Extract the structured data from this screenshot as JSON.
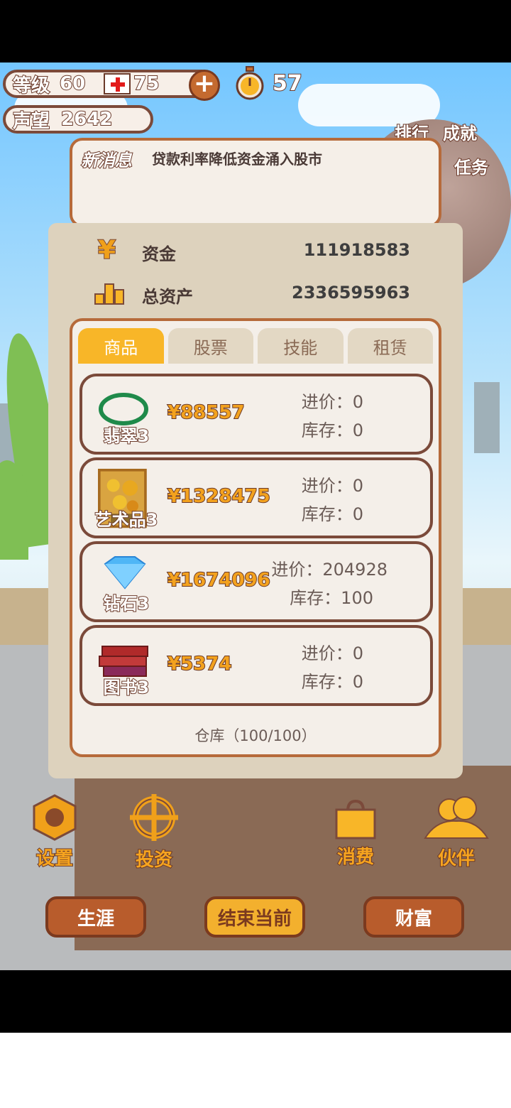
{
  "hud": {
    "level_label": "等级",
    "level_value": "60",
    "health_value": "75",
    "add_label": "+",
    "timer_value": "57",
    "reputation_label": "声望",
    "reputation_value": "2642"
  },
  "side_links": {
    "ranking": "排行",
    "achievements": "成就",
    "tasks": "任务"
  },
  "message": {
    "tag": "新消息",
    "text": "贷款利率降低资金涌入股市"
  },
  "stats": {
    "funds_icon": "¥",
    "funds_label": "资金",
    "funds_value": "111918583",
    "assets_label": "总资产",
    "assets_value": "2336595963"
  },
  "tabs": [
    "商品",
    "股票",
    "技能",
    "租赁"
  ],
  "active_tab": "商品",
  "items": [
    {
      "name": "翡翠3",
      "icon": "jade-bracelet-icon",
      "price": "¥88557",
      "cost": "进价：0",
      "stock": "库存：0"
    },
    {
      "name": "艺术品3",
      "icon": "sunflower-painting-icon",
      "price": "¥1328475",
      "cost": "进价：0",
      "stock": "库存：0"
    },
    {
      "name": "钻石3",
      "icon": "diamond-icon",
      "price": "¥1674096",
      "cost": "进价：204928",
      "stock": "库存：100"
    },
    {
      "name": "图书3",
      "icon": "books-icon",
      "price": "¥5374",
      "cost": "进价：0",
      "stock": "库存：0"
    }
  ],
  "warehouse": "仓库（100/100）",
  "nav": {
    "settings": "设置",
    "invest": "投资",
    "consume": "消费",
    "partner": "伙伴"
  },
  "bottom": {
    "career": "生涯",
    "end_current": "结束当前",
    "wealth": "财富"
  },
  "colors": {
    "accent": "#f8b628",
    "border": "#b66a3a",
    "price": "#f3a21e"
  }
}
